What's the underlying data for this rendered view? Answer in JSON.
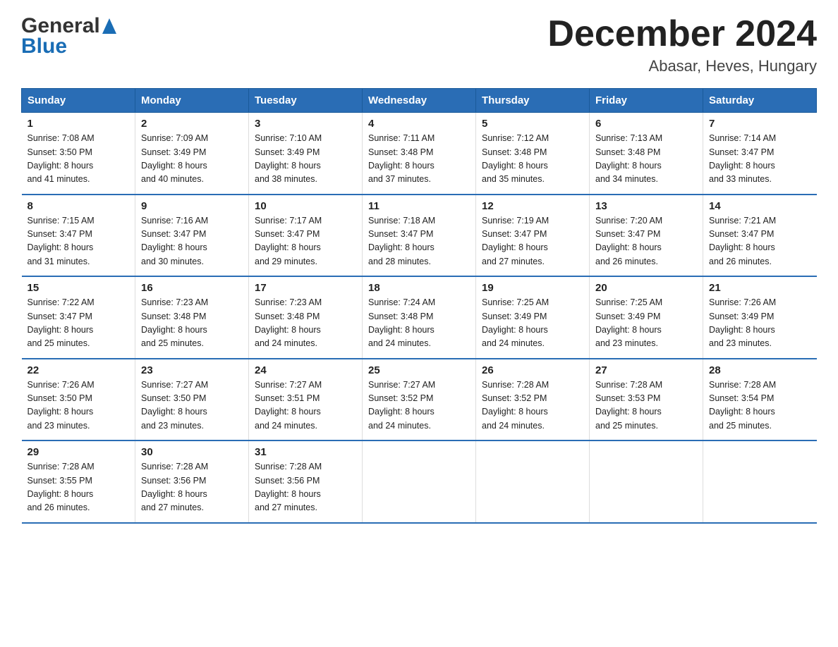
{
  "header": {
    "logo_general": "General",
    "logo_blue": "Blue",
    "month_title": "December 2024",
    "location": "Abasar, Heves, Hungary"
  },
  "columns": [
    "Sunday",
    "Monday",
    "Tuesday",
    "Wednesday",
    "Thursday",
    "Friday",
    "Saturday"
  ],
  "weeks": [
    [
      {
        "day": "1",
        "sunrise": "7:08 AM",
        "sunset": "3:50 PM",
        "daylight": "8 hours and 41 minutes."
      },
      {
        "day": "2",
        "sunrise": "7:09 AM",
        "sunset": "3:49 PM",
        "daylight": "8 hours and 40 minutes."
      },
      {
        "day": "3",
        "sunrise": "7:10 AM",
        "sunset": "3:49 PM",
        "daylight": "8 hours and 38 minutes."
      },
      {
        "day": "4",
        "sunrise": "7:11 AM",
        "sunset": "3:48 PM",
        "daylight": "8 hours and 37 minutes."
      },
      {
        "day": "5",
        "sunrise": "7:12 AM",
        "sunset": "3:48 PM",
        "daylight": "8 hours and 35 minutes."
      },
      {
        "day": "6",
        "sunrise": "7:13 AM",
        "sunset": "3:48 PM",
        "daylight": "8 hours and 34 minutes."
      },
      {
        "day": "7",
        "sunrise": "7:14 AM",
        "sunset": "3:47 PM",
        "daylight": "8 hours and 33 minutes."
      }
    ],
    [
      {
        "day": "8",
        "sunrise": "7:15 AM",
        "sunset": "3:47 PM",
        "daylight": "8 hours and 31 minutes."
      },
      {
        "day": "9",
        "sunrise": "7:16 AM",
        "sunset": "3:47 PM",
        "daylight": "8 hours and 30 minutes."
      },
      {
        "day": "10",
        "sunrise": "7:17 AM",
        "sunset": "3:47 PM",
        "daylight": "8 hours and 29 minutes."
      },
      {
        "day": "11",
        "sunrise": "7:18 AM",
        "sunset": "3:47 PM",
        "daylight": "8 hours and 28 minutes."
      },
      {
        "day": "12",
        "sunrise": "7:19 AM",
        "sunset": "3:47 PM",
        "daylight": "8 hours and 27 minutes."
      },
      {
        "day": "13",
        "sunrise": "7:20 AM",
        "sunset": "3:47 PM",
        "daylight": "8 hours and 26 minutes."
      },
      {
        "day": "14",
        "sunrise": "7:21 AM",
        "sunset": "3:47 PM",
        "daylight": "8 hours and 26 minutes."
      }
    ],
    [
      {
        "day": "15",
        "sunrise": "7:22 AM",
        "sunset": "3:47 PM",
        "daylight": "8 hours and 25 minutes."
      },
      {
        "day": "16",
        "sunrise": "7:23 AM",
        "sunset": "3:48 PM",
        "daylight": "8 hours and 25 minutes."
      },
      {
        "day": "17",
        "sunrise": "7:23 AM",
        "sunset": "3:48 PM",
        "daylight": "8 hours and 24 minutes."
      },
      {
        "day": "18",
        "sunrise": "7:24 AM",
        "sunset": "3:48 PM",
        "daylight": "8 hours and 24 minutes."
      },
      {
        "day": "19",
        "sunrise": "7:25 AM",
        "sunset": "3:49 PM",
        "daylight": "8 hours and 24 minutes."
      },
      {
        "day": "20",
        "sunrise": "7:25 AM",
        "sunset": "3:49 PM",
        "daylight": "8 hours and 23 minutes."
      },
      {
        "day": "21",
        "sunrise": "7:26 AM",
        "sunset": "3:49 PM",
        "daylight": "8 hours and 23 minutes."
      }
    ],
    [
      {
        "day": "22",
        "sunrise": "7:26 AM",
        "sunset": "3:50 PM",
        "daylight": "8 hours and 23 minutes."
      },
      {
        "day": "23",
        "sunrise": "7:27 AM",
        "sunset": "3:50 PM",
        "daylight": "8 hours and 23 minutes."
      },
      {
        "day": "24",
        "sunrise": "7:27 AM",
        "sunset": "3:51 PM",
        "daylight": "8 hours and 24 minutes."
      },
      {
        "day": "25",
        "sunrise": "7:27 AM",
        "sunset": "3:52 PM",
        "daylight": "8 hours and 24 minutes."
      },
      {
        "day": "26",
        "sunrise": "7:28 AM",
        "sunset": "3:52 PM",
        "daylight": "8 hours and 24 minutes."
      },
      {
        "day": "27",
        "sunrise": "7:28 AM",
        "sunset": "3:53 PM",
        "daylight": "8 hours and 25 minutes."
      },
      {
        "day": "28",
        "sunrise": "7:28 AM",
        "sunset": "3:54 PM",
        "daylight": "8 hours and 25 minutes."
      }
    ],
    [
      {
        "day": "29",
        "sunrise": "7:28 AM",
        "sunset": "3:55 PM",
        "daylight": "8 hours and 26 minutes."
      },
      {
        "day": "30",
        "sunrise": "7:28 AM",
        "sunset": "3:56 PM",
        "daylight": "8 hours and 27 minutes."
      },
      {
        "day": "31",
        "sunrise": "7:28 AM",
        "sunset": "3:56 PM",
        "daylight": "8 hours and 27 minutes."
      },
      null,
      null,
      null,
      null
    ]
  ],
  "labels": {
    "sunrise": "Sunrise:",
    "sunset": "Sunset:",
    "daylight": "Daylight:"
  }
}
